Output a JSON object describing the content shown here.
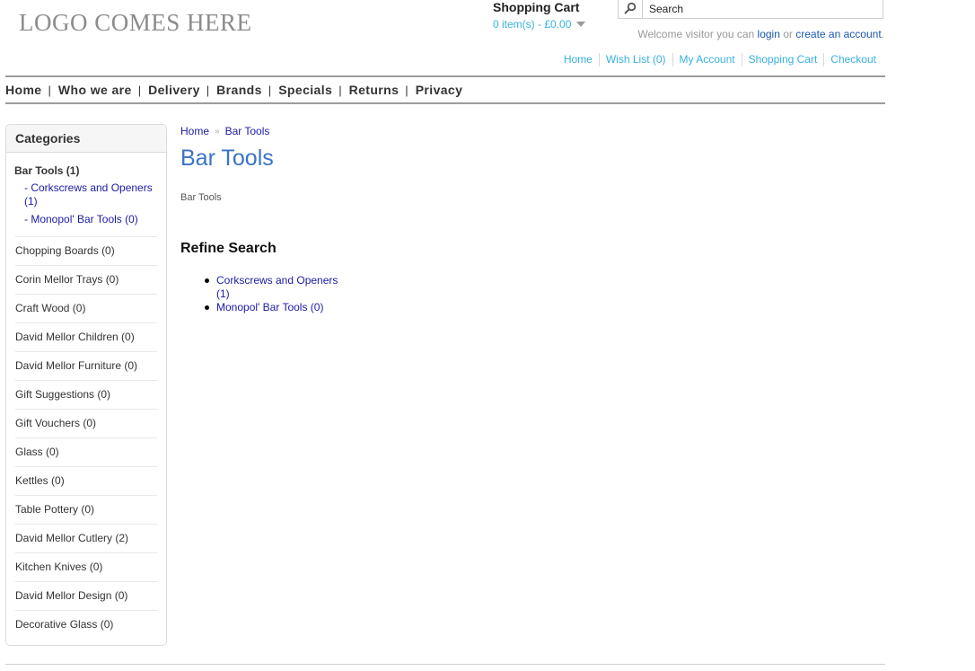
{
  "header": {
    "logo_text": "LOGO COMES HERE",
    "cart": {
      "title": "Shopping Cart",
      "summary": "0 item(s) - £0.00"
    },
    "search": {
      "value": "Search"
    },
    "welcome": {
      "prefix": "Welcome visitor you can",
      "login_label": "login",
      "or": "or",
      "create_label": "create an account",
      "suffix": "."
    },
    "top_links": [
      "Home",
      "Wish List (0)",
      "My Account",
      "Shopping Cart",
      "Checkout"
    ]
  },
  "menu": {
    "items": [
      "Home",
      "Who we are",
      "Delivery",
      "Brands",
      "Specials",
      "Returns",
      "Privacy"
    ],
    "separator": "|"
  },
  "sidebar": {
    "title": "Categories",
    "active": {
      "label": "Bar Tools (1)",
      "children": [
        "- Corkscrews and Openers (1)",
        "- Monopol' Bar Tools (0)"
      ]
    },
    "items": [
      "Chopping Boards (0)",
      "Corin Mellor Trays (0)",
      "Craft Wood (0)",
      "David Mellor Children (0)",
      "David Mellor Furniture (0)",
      "Gift Suggestions (0)",
      "Gift Vouchers (0)",
      "Glass (0)",
      "Kettles (0)",
      "Table Pottery (0)",
      "David Mellor Cutlery (2)",
      "Kitchen Knives (0)",
      "David Mellor Design (0)",
      "Decorative Glass (0)"
    ]
  },
  "content": {
    "breadcrumb": [
      "Home",
      "Bar Tools"
    ],
    "breadcrumb_sep": "»",
    "title": "Bar Tools",
    "description": "Bar Tools",
    "refine_title": "Refine Search",
    "refine_items": [
      "Corkscrews and Openers (1)",
      "Monopol' Bar Tools (0)"
    ]
  },
  "colors": {
    "link_blue": "#1b1ba6",
    "accent_cyan": "#38b0de",
    "title_blue": "#3a73c5",
    "menu_border": "#9c9c9c"
  },
  "icons": {
    "search": "magnifier-icon",
    "cart_dropdown": "chevron-down-icon"
  }
}
